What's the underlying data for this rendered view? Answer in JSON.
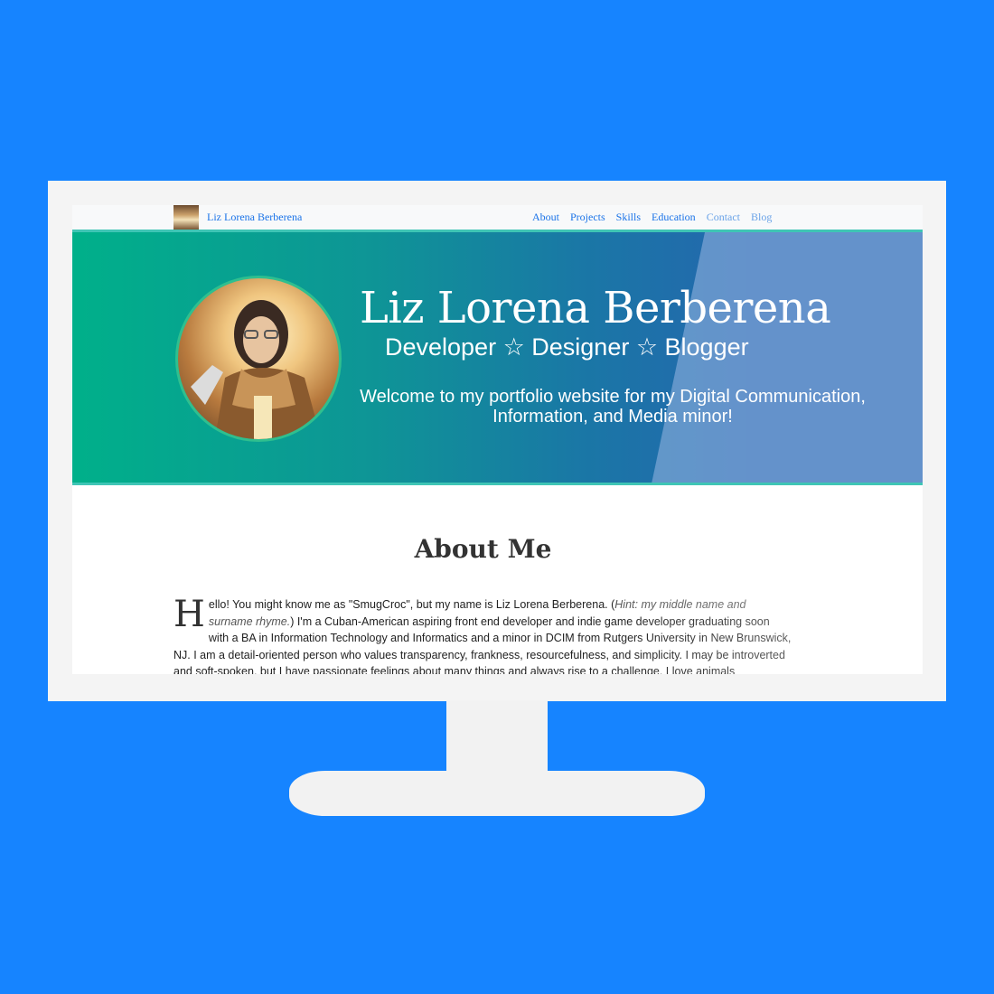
{
  "navbar": {
    "brand": "Liz Lorena Berberena",
    "links": [
      {
        "label": "About"
      },
      {
        "label": "Projects"
      },
      {
        "label": "Skills"
      },
      {
        "label": "Education"
      },
      {
        "label": "Contact"
      },
      {
        "label": "Blog"
      }
    ]
  },
  "hero": {
    "name": "Liz Lorena Berberena",
    "tagline": "Developer ☆ Designer ☆ Blogger",
    "welcome": "Welcome to my portfolio website for my Digital Communication, Information, and Media minor!"
  },
  "about": {
    "title": "About Me",
    "dropcap": "H",
    "intro": "ello! You might know me as \"SmugCroc\", but my name is Liz Lorena Berberena. (",
    "hint": "Hint: my middle name and surname rhyme.",
    "body": ") I'm a Cuban-American aspiring front end developer and indie game developer graduating soon with a BA in Information Technology and Informatics and a minor in DCIM from Rutgers University in New Brunswick, NJ. I am a detail-oriented person who values transparency, frankness, resourcefulness, and simplicity. I may be introverted and soft-spoken, but I have passionate feelings about many things and always rise to a challenge. I love animals (particularly the small ones)"
  },
  "colors": {
    "background": "#1684ff",
    "hero_start": "#00b08a",
    "hero_end": "#2467ae",
    "link": "#1a73e8"
  }
}
